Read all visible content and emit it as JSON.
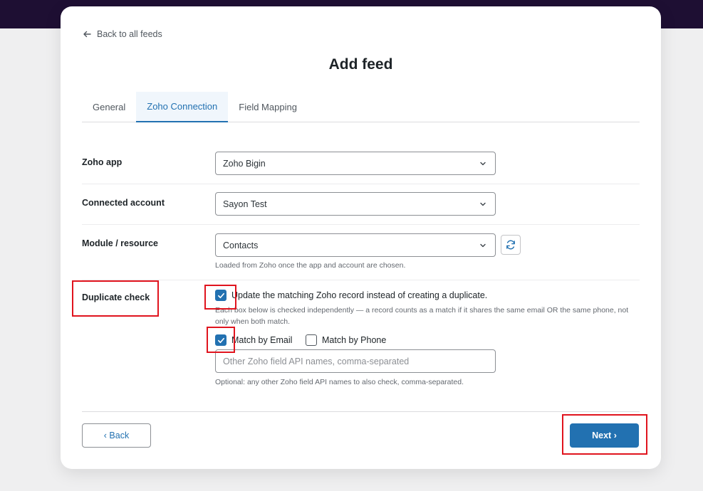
{
  "back_link": "Back to all feeds",
  "page_title": "Add feed",
  "tabs": [
    {
      "label": "General",
      "active": false
    },
    {
      "label": "Zoho Connection",
      "active": true
    },
    {
      "label": "Field Mapping",
      "active": false
    }
  ],
  "form": {
    "zoho_app": {
      "label": "Zoho app",
      "value": "Zoho Bigin"
    },
    "connected_account": {
      "label": "Connected account",
      "value": "Sayon Test"
    },
    "module": {
      "label": "Module / resource",
      "value": "Contacts",
      "hint": "Loaded from Zoho once the app and account are chosen."
    },
    "duplicate_check": {
      "label": "Duplicate check",
      "update_label": "Update the matching Zoho record instead of creating a duplicate.",
      "update_checked": true,
      "description": "Each box below is checked independently — a record counts as a match if it shares the same email OR the same phone, not only when both match.",
      "match_email_label": "Match by Email",
      "match_email_checked": true,
      "match_phone_label": "Match by Phone",
      "match_phone_checked": false,
      "other_fields_placeholder": "Other Zoho field API names, comma-separated",
      "other_fields_hint": "Optional: any other Zoho field API names to also check, comma-separated."
    }
  },
  "footer": {
    "back_label": "‹ Back",
    "next_label": "Next ›"
  },
  "colors": {
    "accent": "#2271b1",
    "highlight": "#e0141e",
    "topbar": "#1e0f33"
  },
  "icons": {
    "back": "arrow-left-icon",
    "dropdown": "chevron-down-icon",
    "refresh": "refresh-icon",
    "check": "checkmark-icon"
  }
}
